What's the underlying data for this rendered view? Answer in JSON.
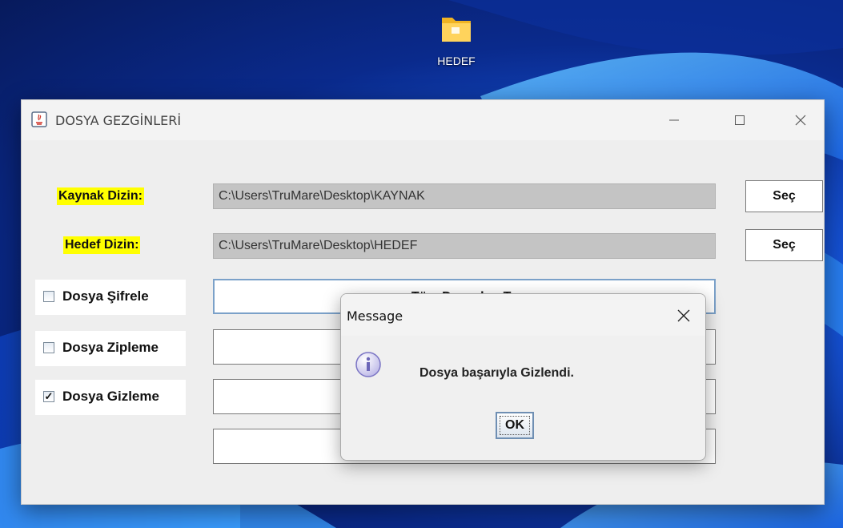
{
  "desktop": {
    "icon_name": "folder-icon",
    "icon_label": "HEDEF"
  },
  "window": {
    "title": "DOSYA GEZGİNLERİ",
    "app_icon": "java-icon",
    "controls": [
      "minimize-icon",
      "maximize-icon",
      "close-icon"
    ]
  },
  "form": {
    "source_label": "Kaynak Dizin:",
    "source_path": "C:\\Users\\TruMare\\Desktop\\KAYNAK",
    "target_label": "Hedef Dizin:",
    "target_path": "C:\\Users\\TruMare\\Desktop\\HEDEF",
    "select_button": "Seç",
    "highlight_color": "#ffff00"
  },
  "options": [
    {
      "label": "Dosya Şifrele",
      "checked": false
    },
    {
      "label": "Dosya Zipleme",
      "checked": false
    },
    {
      "label": "Dosya Gizleme",
      "checked": true
    }
  ],
  "actions": {
    "first_button_partial": "Tüm Dosyaları Ta"
  },
  "dialog": {
    "title": "Message",
    "icon": "info-icon",
    "message": "Dosya başarıyla Gizlendi.",
    "ok_label": "OK"
  }
}
